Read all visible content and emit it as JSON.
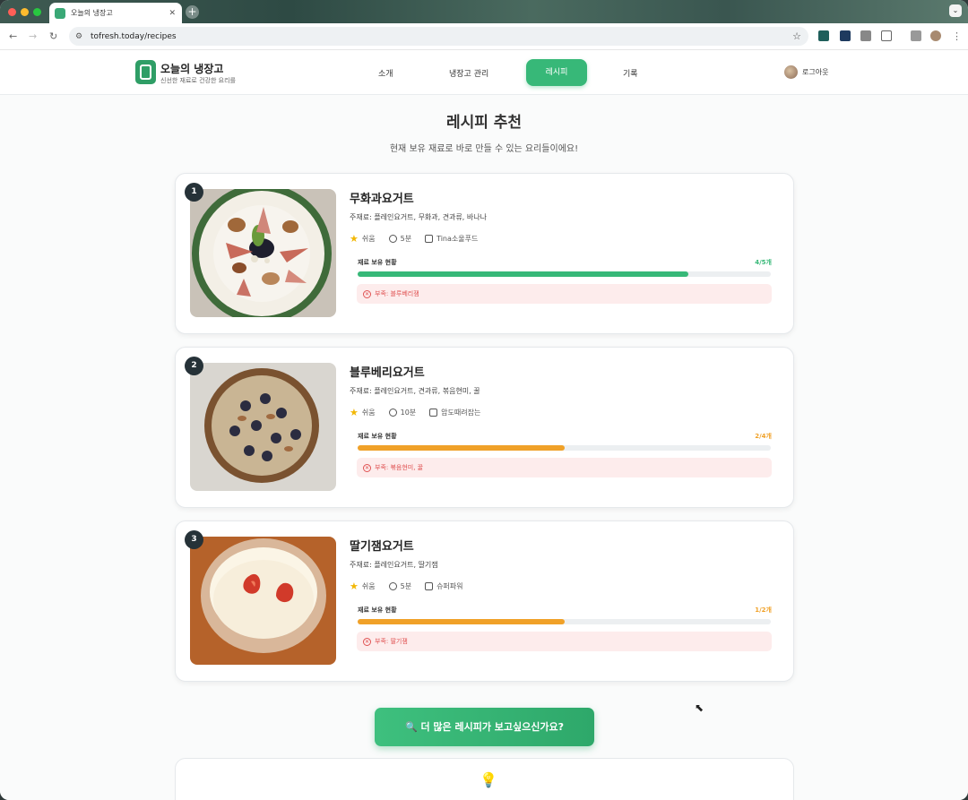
{
  "browser": {
    "tab_title": "오늘의 냉장고",
    "tab_close": "✕",
    "new_tab": "+",
    "url": "tofresh.today/recipes"
  },
  "site": {
    "logo_title": "오늘의 냉장고",
    "logo_subtitle": "신선한 재료로 건강한 요리를",
    "nav": [
      "소개",
      "냉장고 관리",
      "레시피",
      "기록"
    ],
    "logout": "로그아웃"
  },
  "main": {
    "title": "레시피 추천",
    "subtitle": "현재 보유 재료로 바로 만들 수 있는 요리들이에요!",
    "more_button": "🔍 더 많은 레시피가 보고싶으신가요?",
    "bulb_icon": "💡"
  },
  "recipes": [
    {
      "rank": "1",
      "name": "무화과요거트",
      "ingredients": "주재료: 플레인요거트, 무화과, 견과류, 바나나",
      "difficulty": "쉬움",
      "time": "5분",
      "author": "Tina소울푸드",
      "stock_label": "재료 보유 현황",
      "stock_count": "4/5개",
      "stock_ratio": 0.8,
      "bar_color": "#37b878",
      "missing": "부족: 블루베리잼"
    },
    {
      "rank": "2",
      "name": "블루베리요거트",
      "ingredients": "주재료: 플레인요거트, 견과류, 볶음현미, 꿀",
      "difficulty": "쉬움",
      "time": "10분",
      "author": "암도때려잡는",
      "stock_label": "재료 보유 현황",
      "stock_count": "2/4개",
      "stock_ratio": 0.5,
      "bar_color": "#f0a128",
      "missing": "부족: 볶음현미, 꿀"
    },
    {
      "rank": "3",
      "name": "딸기잼요거트",
      "ingredients": "주재료: 플레인요거트, 딸기잼",
      "difficulty": "쉬움",
      "time": "5분",
      "author": "슈퍼파워",
      "stock_label": "재료 보유 현황",
      "stock_count": "1/2개",
      "stock_ratio": 0.5,
      "bar_color": "#f0a128",
      "missing": "부족: 딸기잼"
    }
  ]
}
